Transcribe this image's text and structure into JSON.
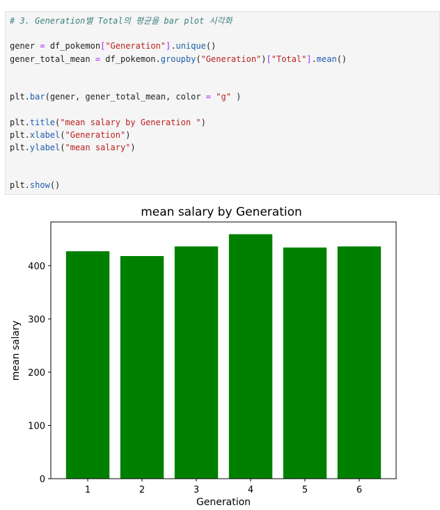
{
  "code_cell": {
    "lines": [
      [
        {
          "t": "# 3. Generation별 Total의 평균을 bar plot 시각화",
          "c": "cm"
        }
      ],
      [],
      [
        {
          "t": "gener "
        },
        {
          "t": "=",
          "c": "op"
        },
        {
          "t": " df_pokemon"
        },
        {
          "t": "[",
          "c": "op"
        },
        {
          "t": "\"Generation\"",
          "c": "str"
        },
        {
          "t": "]",
          "c": "op"
        },
        {
          "t": "."
        },
        {
          "t": "unique",
          "c": "fn"
        },
        {
          "t": "()"
        }
      ],
      [
        {
          "t": "gener_total_mean "
        },
        {
          "t": "=",
          "c": "op"
        },
        {
          "t": " df_pokemon."
        },
        {
          "t": "groupby",
          "c": "fn"
        },
        {
          "t": "("
        },
        {
          "t": "\"Generation\"",
          "c": "str"
        },
        {
          "t": ")"
        },
        {
          "t": "[",
          "c": "op"
        },
        {
          "t": "\"Total\"",
          "c": "str"
        },
        {
          "t": "]",
          "c": "op"
        },
        {
          "t": "."
        },
        {
          "t": "mean",
          "c": "fn"
        },
        {
          "t": "()"
        }
      ],
      [],
      [],
      [
        {
          "t": "plt."
        },
        {
          "t": "bar",
          "c": "fn"
        },
        {
          "t": "(gener, gener_total_mean, color "
        },
        {
          "t": "=",
          "c": "op"
        },
        {
          "t": " "
        },
        {
          "t": "\"g\"",
          "c": "str"
        },
        {
          "t": " )"
        }
      ],
      [],
      [
        {
          "t": "plt."
        },
        {
          "t": "title",
          "c": "fn"
        },
        {
          "t": "("
        },
        {
          "t": "\"mean salary by Generation \"",
          "c": "str"
        },
        {
          "t": ")"
        }
      ],
      [
        {
          "t": "plt."
        },
        {
          "t": "xlabel",
          "c": "fn"
        },
        {
          "t": "("
        },
        {
          "t": "\"Generation\"",
          "c": "str"
        },
        {
          "t": ")"
        }
      ],
      [
        {
          "t": "plt."
        },
        {
          "t": "ylabel",
          "c": "fn"
        },
        {
          "t": "("
        },
        {
          "t": "\"mean salary\"",
          "c": "str"
        },
        {
          "t": ")"
        }
      ],
      [],
      [],
      [
        {
          "t": "plt."
        },
        {
          "t": "show",
          "c": "fn"
        },
        {
          "t": "()"
        }
      ]
    ]
  },
  "chart_data": {
    "type": "bar",
    "title": "mean salary by Generation",
    "xlabel": "Generation",
    "ylabel": "mean salary",
    "categories": [
      "1",
      "2",
      "3",
      "4",
      "5",
      "6"
    ],
    "values": [
      427,
      418,
      436,
      459,
      434,
      436
    ],
    "ylim": [
      0,
      482
    ],
    "yticks": [
      0,
      100,
      200,
      300,
      400
    ],
    "bar_color": "#008000",
    "grid": false
  }
}
